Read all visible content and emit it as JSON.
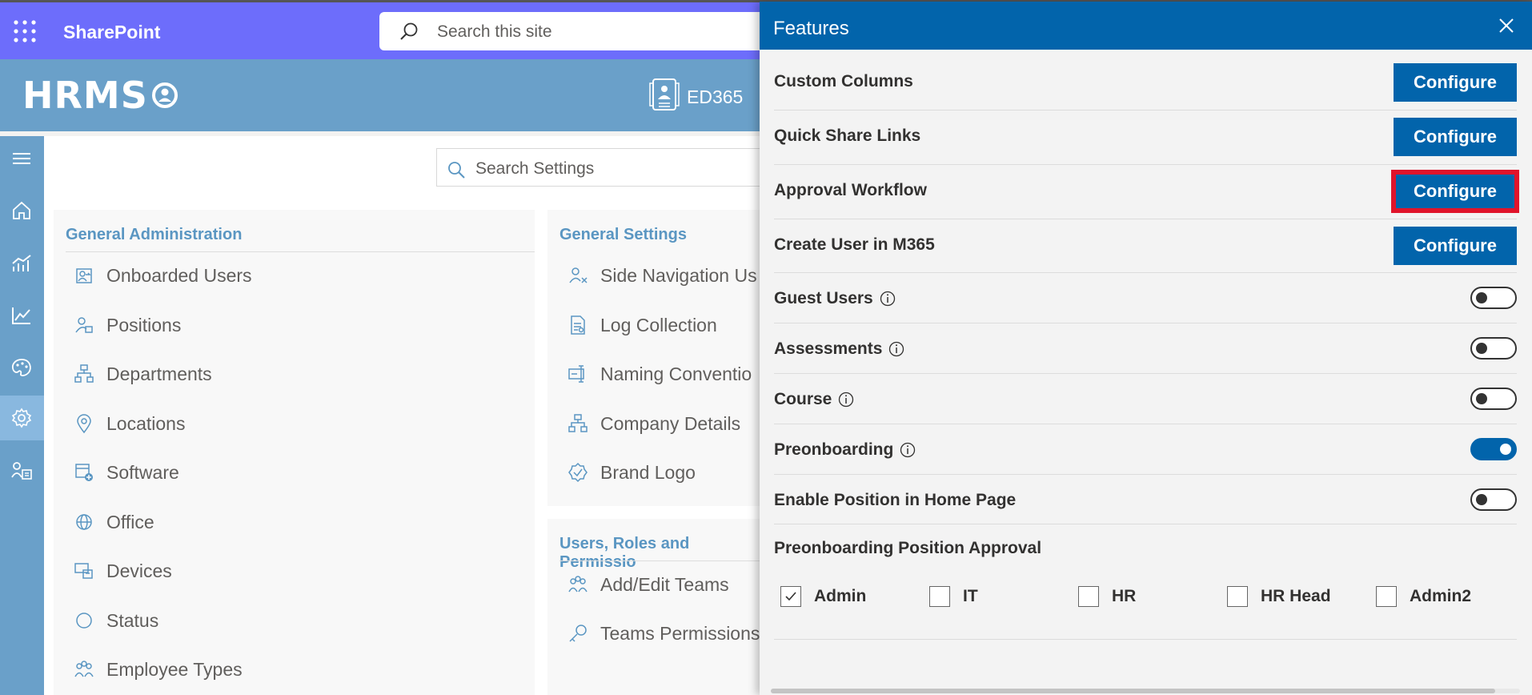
{
  "suitebar": {
    "app_name": "SharePoint",
    "search_placeholder": "Search this site"
  },
  "header": {
    "logo_text": "HRMS",
    "badge_label": "ED365"
  },
  "rail": {
    "items": [
      "menu-icon",
      "home-icon",
      "analytics-icon",
      "trend-icon",
      "palette-icon",
      "settings-icon",
      "users-org-icon"
    ],
    "active": "settings-icon"
  },
  "main": {
    "search_placeholder": "Search Settings",
    "general_admin": {
      "title": "General Administration",
      "items": [
        "Onboarded Users",
        "Positions",
        "Departments",
        "Locations",
        "Software",
        "Office",
        "Devices",
        "Status",
        "Employee Types"
      ]
    },
    "general_settings": {
      "title": "General Settings",
      "items": [
        "Side Navigation Us",
        "Log Collection",
        "Naming Conventio",
        "Company Details",
        "Brand Logo"
      ]
    },
    "users_roles": {
      "title": "Users, Roles and Permissio",
      "items": [
        "Add/Edit Teams",
        "Teams Permissions"
      ]
    }
  },
  "features": {
    "title": "Features",
    "configure_rows": [
      {
        "label": "Custom Columns",
        "button": "Configure"
      },
      {
        "label": "Quick Share Links",
        "button": "Configure"
      },
      {
        "label": "Approval Workflow",
        "button": "Configure"
      },
      {
        "label": "Create User in M365",
        "button": "Configure"
      }
    ],
    "toggle_rows": [
      {
        "label": "Guest Users",
        "info": true,
        "on": false
      },
      {
        "label": "Assessments",
        "info": true,
        "on": false
      },
      {
        "label": "Course",
        "info": true,
        "on": false
      },
      {
        "label": "Preonboarding",
        "info": true,
        "on": true
      },
      {
        "label": "Enable Position in Home Page",
        "info": false,
        "on": false
      }
    ],
    "approval_section": {
      "label": "Preonboarding Position Approval",
      "roles": [
        {
          "label": "Admin",
          "checked": true
        },
        {
          "label": "IT",
          "checked": false
        },
        {
          "label": "HR",
          "checked": false
        },
        {
          "label": "HR Head",
          "checked": false
        },
        {
          "label": "Admin2",
          "checked": false
        }
      ]
    },
    "accent": "#0264ab",
    "highlight": "#e0142b"
  }
}
